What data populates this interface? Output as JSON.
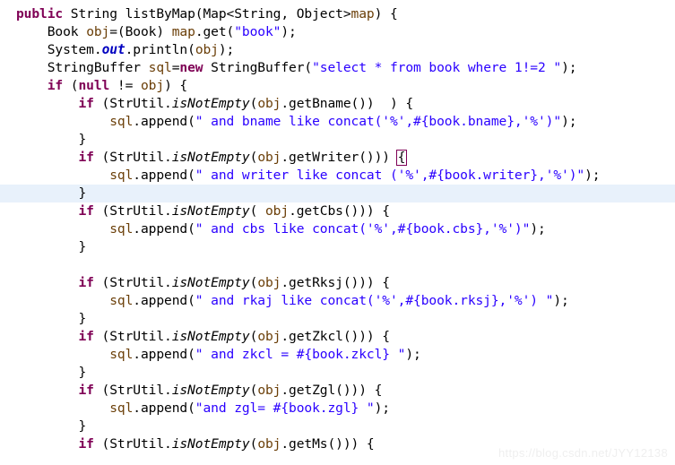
{
  "editor": {
    "language": "java",
    "theme": "eclipse-light",
    "background_color": "#ffffff",
    "current_line_highlight_color": "#e8f1fb",
    "colors": {
      "keyword": "#7f0055",
      "string": "#2a00ff",
      "local_variable": "#6a3e07",
      "static_field": "#0000c0",
      "plain_text": "#000000",
      "bracket_match_outline": "#7f0055",
      "watermark": "#efefef"
    },
    "caret_line_number": 12,
    "bracket_match_line_number": 10
  },
  "watermark": {
    "text": "https://blog.csdn.net/JYY12138"
  },
  "code": {
    "lines": [
      {
        "n": 1,
        "indent": 0,
        "current": false,
        "tokens": [
          {
            "t": "public",
            "c": "kw"
          },
          {
            "t": " String listByMap(Map<String, Object>",
            "c": "pln"
          },
          {
            "t": "map",
            "c": "var"
          },
          {
            "t": ") {",
            "c": "pln"
          }
        ]
      },
      {
        "n": 2,
        "indent": 1,
        "current": false,
        "tokens": [
          {
            "t": "Book ",
            "c": "pln"
          },
          {
            "t": "obj",
            "c": "var"
          },
          {
            "t": "=(Book) ",
            "c": "pln"
          },
          {
            "t": "map",
            "c": "var"
          },
          {
            "t": ".get(",
            "c": "pln"
          },
          {
            "t": "\"book\"",
            "c": "str"
          },
          {
            "t": ");",
            "c": "pln"
          }
        ]
      },
      {
        "n": 3,
        "indent": 1,
        "current": false,
        "tokens": [
          {
            "t": "System.",
            "c": "pln"
          },
          {
            "t": "out",
            "c": "sfld"
          },
          {
            "t": ".println(",
            "c": "pln"
          },
          {
            "t": "obj",
            "c": "var"
          },
          {
            "t": ");",
            "c": "pln"
          }
        ]
      },
      {
        "n": 4,
        "indent": 1,
        "current": false,
        "tokens": [
          {
            "t": "StringBuffer ",
            "c": "pln"
          },
          {
            "t": "sql",
            "c": "var"
          },
          {
            "t": "=",
            "c": "pln"
          },
          {
            "t": "new",
            "c": "kw"
          },
          {
            "t": " StringBuffer(",
            "c": "pln"
          },
          {
            "t": "\"select * from book where 1!=2 \"",
            "c": "str"
          },
          {
            "t": ");",
            "c": "pln"
          }
        ]
      },
      {
        "n": 5,
        "indent": 1,
        "current": false,
        "tokens": [
          {
            "t": "if",
            "c": "kw"
          },
          {
            "t": " (",
            "c": "pln"
          },
          {
            "t": "null",
            "c": "kw"
          },
          {
            "t": " != ",
            "c": "pln"
          },
          {
            "t": "obj",
            "c": "var"
          },
          {
            "t": ") {",
            "c": "pln"
          }
        ]
      },
      {
        "n": 6,
        "indent": 2,
        "current": false,
        "tokens": [
          {
            "t": "if",
            "c": "kw"
          },
          {
            "t": " (StrUtil.",
            "c": "pln"
          },
          {
            "t": "isNotEmpty",
            "c": "smth"
          },
          {
            "t": "(",
            "c": "pln"
          },
          {
            "t": "obj",
            "c": "var"
          },
          {
            "t": ".getBname())  ) {",
            "c": "pln"
          }
        ]
      },
      {
        "n": 7,
        "indent": 3,
        "current": false,
        "tokens": [
          {
            "t": "sql",
            "c": "var"
          },
          {
            "t": ".append(",
            "c": "pln"
          },
          {
            "t": "\" and bname like concat('%',#{book.bname},'%')\"",
            "c": "str"
          },
          {
            "t": ");",
            "c": "pln"
          }
        ]
      },
      {
        "n": 8,
        "indent": 2,
        "current": false,
        "tokens": [
          {
            "t": "}",
            "c": "pln"
          }
        ]
      },
      {
        "n": 9,
        "indent": 2,
        "current": false,
        "tokens": [
          {
            "t": "if",
            "c": "kw"
          },
          {
            "t": " (StrUtil.",
            "c": "pln"
          },
          {
            "t": "isNotEmpty",
            "c": "smth"
          },
          {
            "t": "(",
            "c": "pln"
          },
          {
            "t": "obj",
            "c": "var"
          },
          {
            "t": ".getWriter())) ",
            "c": "pln"
          },
          {
            "t": "{",
            "c": "pln",
            "bracket": true
          }
        ]
      },
      {
        "n": 10,
        "indent": 3,
        "current": false,
        "tokens": [
          {
            "t": "sql",
            "c": "var"
          },
          {
            "t": ".append(",
            "c": "pln"
          },
          {
            "t": "\" and writer like concat ('%',#{book.writer},'%')\"",
            "c": "str"
          },
          {
            "t": ");",
            "c": "pln"
          }
        ]
      },
      {
        "n": 11,
        "indent": 2,
        "current": true,
        "tokens": [
          {
            "t": "}",
            "c": "pln"
          }
        ]
      },
      {
        "n": 12,
        "indent": 2,
        "current": false,
        "tokens": [
          {
            "t": "if",
            "c": "kw"
          },
          {
            "t": " (StrUtil.",
            "c": "pln"
          },
          {
            "t": "isNotEmpty",
            "c": "smth"
          },
          {
            "t": "( ",
            "c": "pln"
          },
          {
            "t": "obj",
            "c": "var"
          },
          {
            "t": ".getCbs())) {",
            "c": "pln"
          }
        ]
      },
      {
        "n": 13,
        "indent": 3,
        "current": false,
        "tokens": [
          {
            "t": "sql",
            "c": "var"
          },
          {
            "t": ".append(",
            "c": "pln"
          },
          {
            "t": "\" and cbs like concat('%',#{book.cbs},'%')\"",
            "c": "str"
          },
          {
            "t": ");",
            "c": "pln"
          }
        ]
      },
      {
        "n": 14,
        "indent": 2,
        "current": false,
        "tokens": [
          {
            "t": "}",
            "c": "pln"
          }
        ]
      },
      {
        "n": 15,
        "indent": 0,
        "current": false,
        "tokens": []
      },
      {
        "n": 16,
        "indent": 2,
        "current": false,
        "tokens": [
          {
            "t": "if",
            "c": "kw"
          },
          {
            "t": " (StrUtil.",
            "c": "pln"
          },
          {
            "t": "isNotEmpty",
            "c": "smth"
          },
          {
            "t": "(",
            "c": "pln"
          },
          {
            "t": "obj",
            "c": "var"
          },
          {
            "t": ".getRksj())) {",
            "c": "pln"
          }
        ]
      },
      {
        "n": 17,
        "indent": 3,
        "current": false,
        "tokens": [
          {
            "t": "sql",
            "c": "var"
          },
          {
            "t": ".append(",
            "c": "pln"
          },
          {
            "t": "\" and rkaj like concat('%',#{book.rksj},'%') \"",
            "c": "str"
          },
          {
            "t": ");",
            "c": "pln"
          }
        ]
      },
      {
        "n": 18,
        "indent": 2,
        "current": false,
        "tokens": [
          {
            "t": "}",
            "c": "pln"
          }
        ]
      },
      {
        "n": 19,
        "indent": 2,
        "current": false,
        "tokens": [
          {
            "t": "if",
            "c": "kw"
          },
          {
            "t": " (StrUtil.",
            "c": "pln"
          },
          {
            "t": "isNotEmpty",
            "c": "smth"
          },
          {
            "t": "(",
            "c": "pln"
          },
          {
            "t": "obj",
            "c": "var"
          },
          {
            "t": ".getZkcl())) {",
            "c": "pln"
          }
        ]
      },
      {
        "n": 20,
        "indent": 3,
        "current": false,
        "tokens": [
          {
            "t": "sql",
            "c": "var"
          },
          {
            "t": ".append(",
            "c": "pln"
          },
          {
            "t": "\" and zkcl = #{book.zkcl} \"",
            "c": "str"
          },
          {
            "t": ");",
            "c": "pln"
          }
        ]
      },
      {
        "n": 21,
        "indent": 2,
        "current": false,
        "tokens": [
          {
            "t": "}",
            "c": "pln"
          }
        ]
      },
      {
        "n": 22,
        "indent": 2,
        "current": false,
        "tokens": [
          {
            "t": "if",
            "c": "kw"
          },
          {
            "t": " (StrUtil.",
            "c": "pln"
          },
          {
            "t": "isNotEmpty",
            "c": "smth"
          },
          {
            "t": "(",
            "c": "pln"
          },
          {
            "t": "obj",
            "c": "var"
          },
          {
            "t": ".getZgl())) {",
            "c": "pln"
          }
        ]
      },
      {
        "n": 23,
        "indent": 3,
        "current": false,
        "tokens": [
          {
            "t": "sql",
            "c": "var"
          },
          {
            "t": ".append(",
            "c": "pln"
          },
          {
            "t": "\"and zgl= #{book.zgl} \"",
            "c": "str"
          },
          {
            "t": ");",
            "c": "pln"
          }
        ]
      },
      {
        "n": 24,
        "indent": 2,
        "current": false,
        "tokens": [
          {
            "t": "}",
            "c": "pln"
          }
        ]
      },
      {
        "n": 25,
        "indent": 2,
        "current": false,
        "tokens": [
          {
            "t": "if",
            "c": "kw"
          },
          {
            "t": " (StrUtil.",
            "c": "pln"
          },
          {
            "t": "isNotEmpty",
            "c": "smth"
          },
          {
            "t": "(",
            "c": "pln"
          },
          {
            "t": "obj",
            "c": "var"
          },
          {
            "t": ".getMs())) {",
            "c": "pln"
          }
        ]
      }
    ]
  }
}
